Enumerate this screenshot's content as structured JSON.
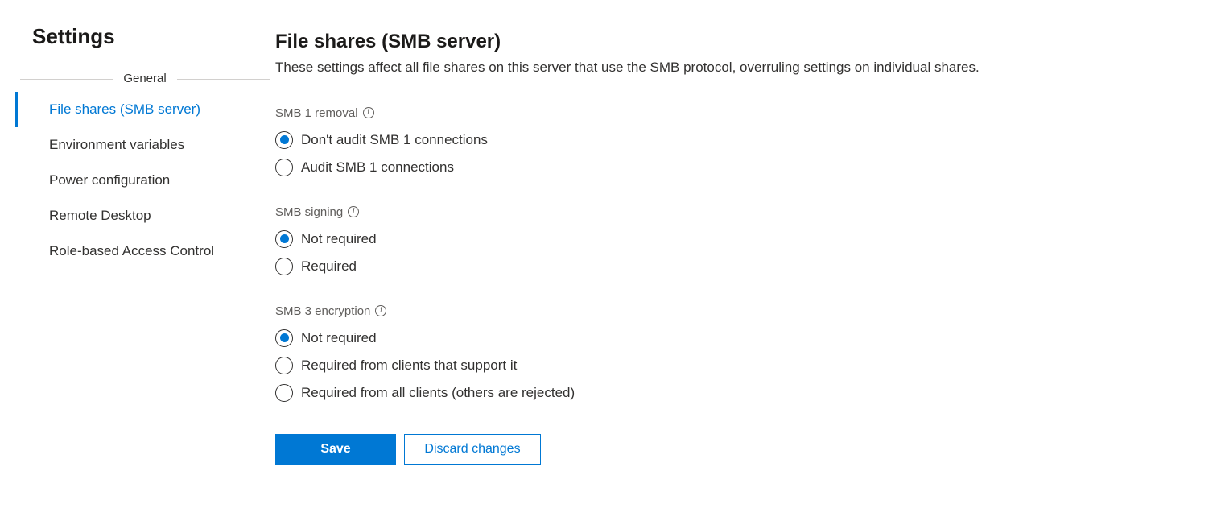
{
  "sidebar": {
    "title": "Settings",
    "section": "General",
    "items": [
      {
        "label": "File shares (SMB server)",
        "active": true
      },
      {
        "label": "Environment variables",
        "active": false
      },
      {
        "label": "Power configuration",
        "active": false
      },
      {
        "label": "Remote Desktop",
        "active": false
      },
      {
        "label": "Role-based Access Control",
        "active": false
      }
    ]
  },
  "main": {
    "title": "File shares (SMB server)",
    "description": "These settings affect all file shares on this server that use the SMB protocol, overruling settings on individual shares.",
    "groups": [
      {
        "label": "SMB 1 removal",
        "options": [
          {
            "label": "Don't audit SMB 1 connections",
            "checked": true
          },
          {
            "label": "Audit SMB 1 connections",
            "checked": false
          }
        ]
      },
      {
        "label": "SMB signing",
        "options": [
          {
            "label": "Not required",
            "checked": true
          },
          {
            "label": "Required",
            "checked": false
          }
        ]
      },
      {
        "label": "SMB 3 encryption",
        "options": [
          {
            "label": "Not required",
            "checked": true
          },
          {
            "label": "Required from clients that support it",
            "checked": false
          },
          {
            "label": "Required from all clients (others are rejected)",
            "checked": false
          }
        ]
      }
    ],
    "buttons": {
      "save": "Save",
      "discard": "Discard changes"
    }
  }
}
